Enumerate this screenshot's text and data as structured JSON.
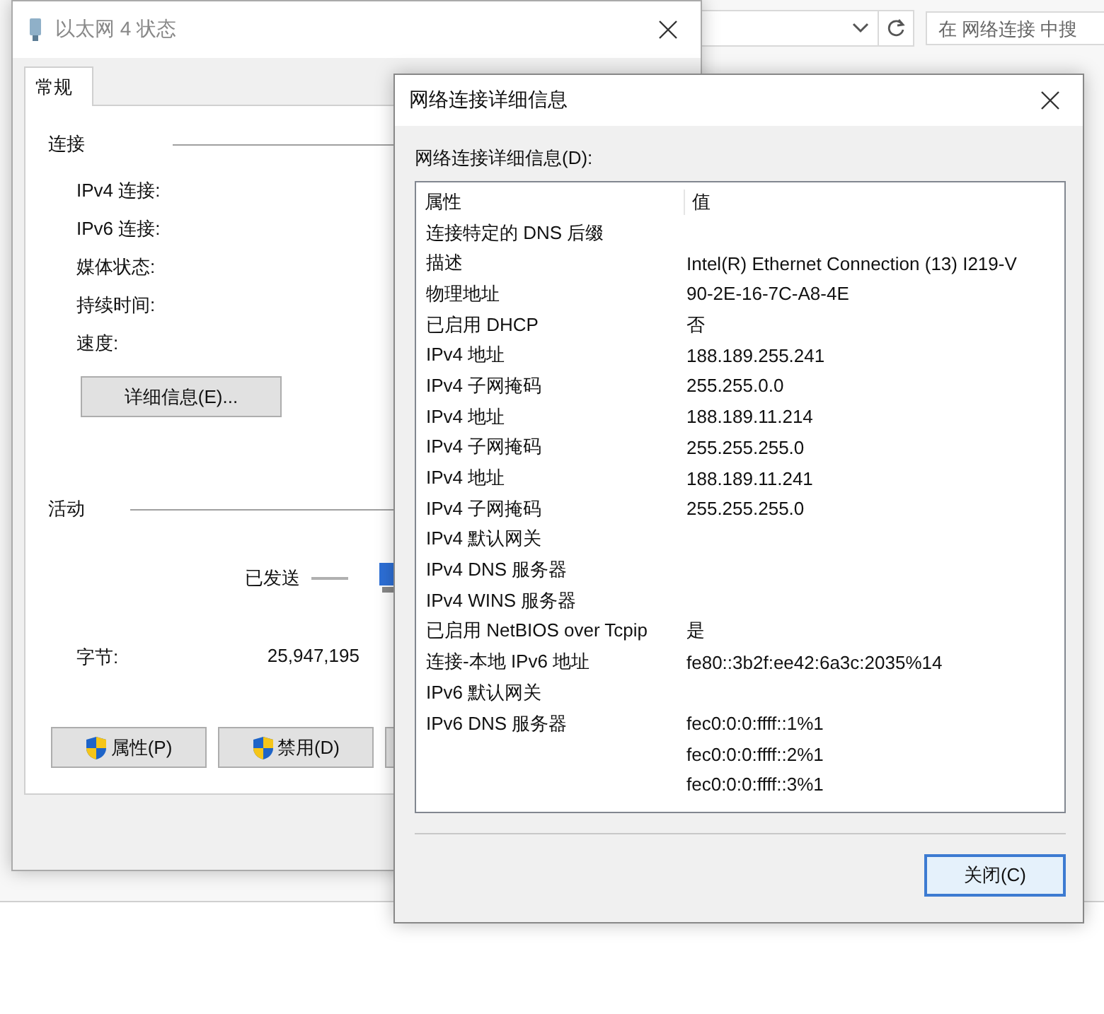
{
  "explorer": {
    "search": {
      "placeholder": "在 网络连接 中搜"
    }
  },
  "status_dialog": {
    "title": "以太网 4 状态",
    "tabs": [
      {
        "label": "常规",
        "selected": true
      }
    ],
    "connection": {
      "heading": "连接",
      "fields": [
        "IPv4 连接:",
        "IPv6 连接:",
        "媒体状态:",
        "持续时间:",
        "速度:"
      ],
      "details_button": "详细信息(E)..."
    },
    "activity": {
      "heading": "活动",
      "sent_label": "已发送",
      "bytes_label": "字节:",
      "bytes_sent": "25,947,195"
    },
    "buttons": [
      {
        "label": "属性(P)"
      },
      {
        "label": "禁用(D)"
      }
    ]
  },
  "details_dialog": {
    "title": "网络连接详细信息",
    "list_label": "网络连接详细信息(D):",
    "columns": [
      "属性",
      "值"
    ],
    "rows": [
      {
        "property": "连接特定的 DNS 后缀"
      },
      {
        "property": "描述",
        "value": "Intel(R) Ethernet Connection (13) I219-V"
      },
      {
        "property": "物理地址",
        "value": "90-2E-16-7C-A8-4E"
      },
      {
        "property": "已启用 DHCP",
        "value": "否"
      },
      {
        "property": "IPv4 地址",
        "value": "188.189.255.241"
      },
      {
        "property": "IPv4 子网掩码",
        "value": "255.255.0.0"
      },
      {
        "property": "IPv4 地址",
        "value": "188.189.11.214"
      },
      {
        "property": "IPv4 子网掩码",
        "value": "255.255.255.0"
      },
      {
        "property": "IPv4 地址",
        "value": "188.189.11.241"
      },
      {
        "property": "IPv4 子网掩码",
        "value": "255.255.255.0"
      },
      {
        "property": "IPv4 默认网关"
      },
      {
        "property": "IPv4 DNS 服务器"
      },
      {
        "property": "IPv4 WINS 服务器"
      },
      {
        "property": "已启用 NetBIOS over Tcpip",
        "value": "是"
      },
      {
        "property": "连接-本地 IPv6 地址",
        "value": "fe80::3b2f:ee42:6a3c:2035%14"
      },
      {
        "property": "IPv6 默认网关"
      },
      {
        "property": "IPv6 DNS 服务器",
        "value": "fec0:0:0:ffff::1%1"
      },
      {
        "value": "fec0:0:0:ffff::2%1"
      },
      {
        "value": "fec0:0:0:ffff::3%1"
      }
    ],
    "close_button": "关闭(C)"
  }
}
